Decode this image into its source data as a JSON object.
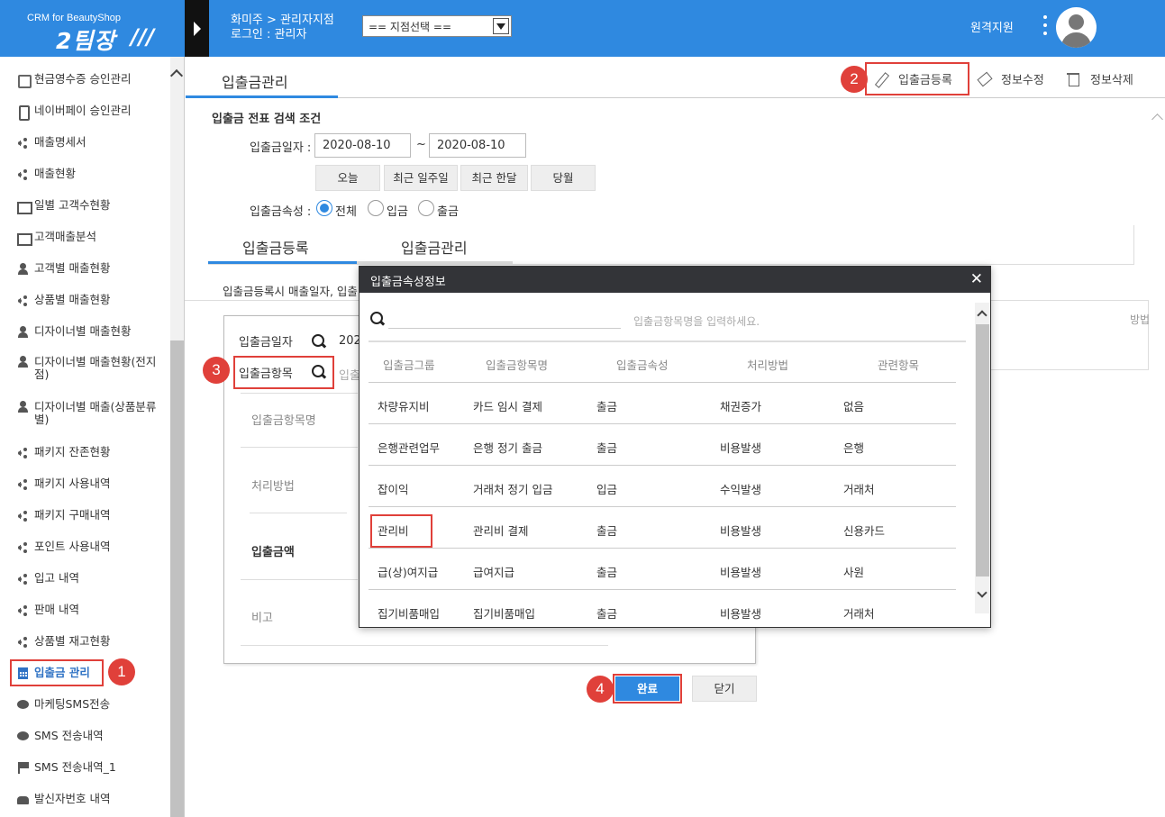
{
  "logo": {
    "sub": "CRM for BeautyShop",
    "main": "2팀장"
  },
  "header": {
    "shop_name": "화미주 > 관리자지점",
    "login": "로그인 : 관리자",
    "branch_select": "== 지점선택 ==",
    "remote_support": "원격지원"
  },
  "sidebar": {
    "items": [
      {
        "label": "현금영수증 승인관리",
        "icon": "database-icon"
      },
      {
        "label": "네이버페이 승인관리",
        "icon": "phone-icon"
      },
      {
        "label": "매출명세서",
        "icon": "share-icon"
      },
      {
        "label": "매출현황",
        "icon": "share-icon"
      },
      {
        "label": "일별 고객수현황",
        "icon": "id-card-icon"
      },
      {
        "label": "고객매출분석",
        "icon": "id-card-icon"
      },
      {
        "label": "고객별 매출현황",
        "icon": "user-icon"
      },
      {
        "label": "상품별 매출현황",
        "icon": "share-icon"
      },
      {
        "label": "디자이너별 매출현황",
        "icon": "user-icon"
      },
      {
        "label": "디자이너별 매출현황(전지점)",
        "icon": "user-icon"
      },
      {
        "label": "디자이너별 매출(상품분류별)",
        "icon": "user-icon"
      },
      {
        "label": "패키지 잔존현황",
        "icon": "share-icon"
      },
      {
        "label": "패키지 사용내역",
        "icon": "share-icon"
      },
      {
        "label": "패키지 구매내역",
        "icon": "share-icon"
      },
      {
        "label": "포인트 사용내역",
        "icon": "share-icon"
      },
      {
        "label": "입고 내역",
        "icon": "share-icon"
      },
      {
        "label": "판매 내역",
        "icon": "share-icon"
      },
      {
        "label": "상품별 재고현황",
        "icon": "share-icon"
      },
      {
        "label": "입출금 관리",
        "icon": "calculator-icon"
      },
      {
        "label": "마케팅SMS전송",
        "icon": "chat-icon"
      },
      {
        "label": "SMS 전송내역",
        "icon": "chat-icon"
      },
      {
        "label": "SMS 전송내역_1",
        "icon": "flag-icon"
      },
      {
        "label": "발신자번호 내역",
        "icon": "telephone-icon"
      }
    ]
  },
  "main": {
    "tab": "입출금관리",
    "toolbar": {
      "register": "입출금등록",
      "edit": "정보수정",
      "delete": "정보삭제"
    },
    "search": {
      "title": "입출금 전표 검색 조건",
      "date_label": "입출금일자 :",
      "date_from": "2020-08-10",
      "tilde": "~",
      "date_to": "2020-08-10",
      "quick": [
        "오늘",
        "최근 일주일",
        "최근 한달",
        "당월"
      ],
      "type_label": "입출금속성 :",
      "types": [
        "전체",
        "입금",
        "출금"
      ]
    },
    "subtabs": [
      "입출금등록",
      "입출금관리"
    ],
    "notice": "입출금등록시 매출일자, 입출",
    "right_fragment": "방법",
    "form": {
      "date_label": "입출금일자",
      "date_value": "202",
      "item_label": "입출금항목",
      "item_placeholder": "입출",
      "item_name": "입출금항목명",
      "method": "처리방법",
      "amount": "입출금액",
      "memo": "비고"
    },
    "done": "완료",
    "close": "닫기"
  },
  "modal": {
    "title": "입출금속성정보",
    "close": "✕",
    "search_placeholder": "입출금항목명을 입력하세요.",
    "columns": [
      "입출금그룹",
      "입출금항목명",
      "입출금속성",
      "처리방법",
      "관련항목"
    ],
    "rows": [
      [
        "차량유지비",
        "카드 임시 결제",
        "출금",
        "채권증가",
        "없음"
      ],
      [
        "은행관련업무",
        "은행 정기 출금",
        "출금",
        "비용발생",
        "은행"
      ],
      [
        "잡이익",
        "거래처 정기 입금",
        "입금",
        "수익발생",
        "거래처"
      ],
      [
        "관리비",
        "관리비 결제",
        "출금",
        "비용발생",
        "신용카드"
      ],
      [
        "급(상)여지급",
        "급여지급",
        "출금",
        "비용발생",
        "사원"
      ],
      [
        "집기비품매입",
        "집기비품매입",
        "출금",
        "비용발생",
        "거래처"
      ]
    ]
  },
  "badges": [
    "1",
    "2",
    "3",
    "4"
  ],
  "colors": {
    "brand": "#2f89e0",
    "annotation": "#e0403a",
    "modal_header": "#333438"
  }
}
